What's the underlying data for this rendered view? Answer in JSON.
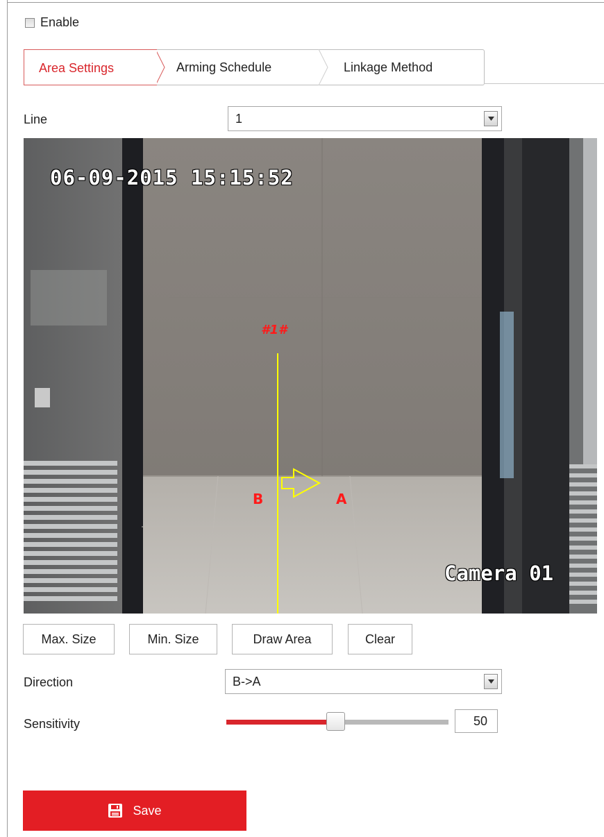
{
  "enable": {
    "label": "Enable",
    "checked": false
  },
  "tabs": [
    {
      "label": "Area Settings",
      "active": true
    },
    {
      "label": "Arming Schedule",
      "active": false
    },
    {
      "label": "Linkage Method",
      "active": false
    }
  ],
  "line": {
    "label": "Line",
    "value": "1"
  },
  "video": {
    "timestamp": "06-09-2015 15:15:52",
    "camera_name": "Camera 01",
    "line_id": "#1#",
    "side_b": "B",
    "side_a": "A",
    "line_color": "#ffff00",
    "label_color": "#ff1a1a"
  },
  "buttons": {
    "max_size": "Max. Size",
    "min_size": "Min. Size",
    "draw_area": "Draw Area",
    "clear": "Clear"
  },
  "direction": {
    "label": "Direction",
    "value": "B->A"
  },
  "sensitivity": {
    "label": "Sensitivity",
    "value": "50",
    "level_percent": 50
  },
  "save": {
    "label": "Save",
    "icon": "floppy-disk-icon",
    "color": "#e31e24"
  },
  "colors": {
    "accent": "#d9262c",
    "tab_active_border": "#d85a5a"
  }
}
